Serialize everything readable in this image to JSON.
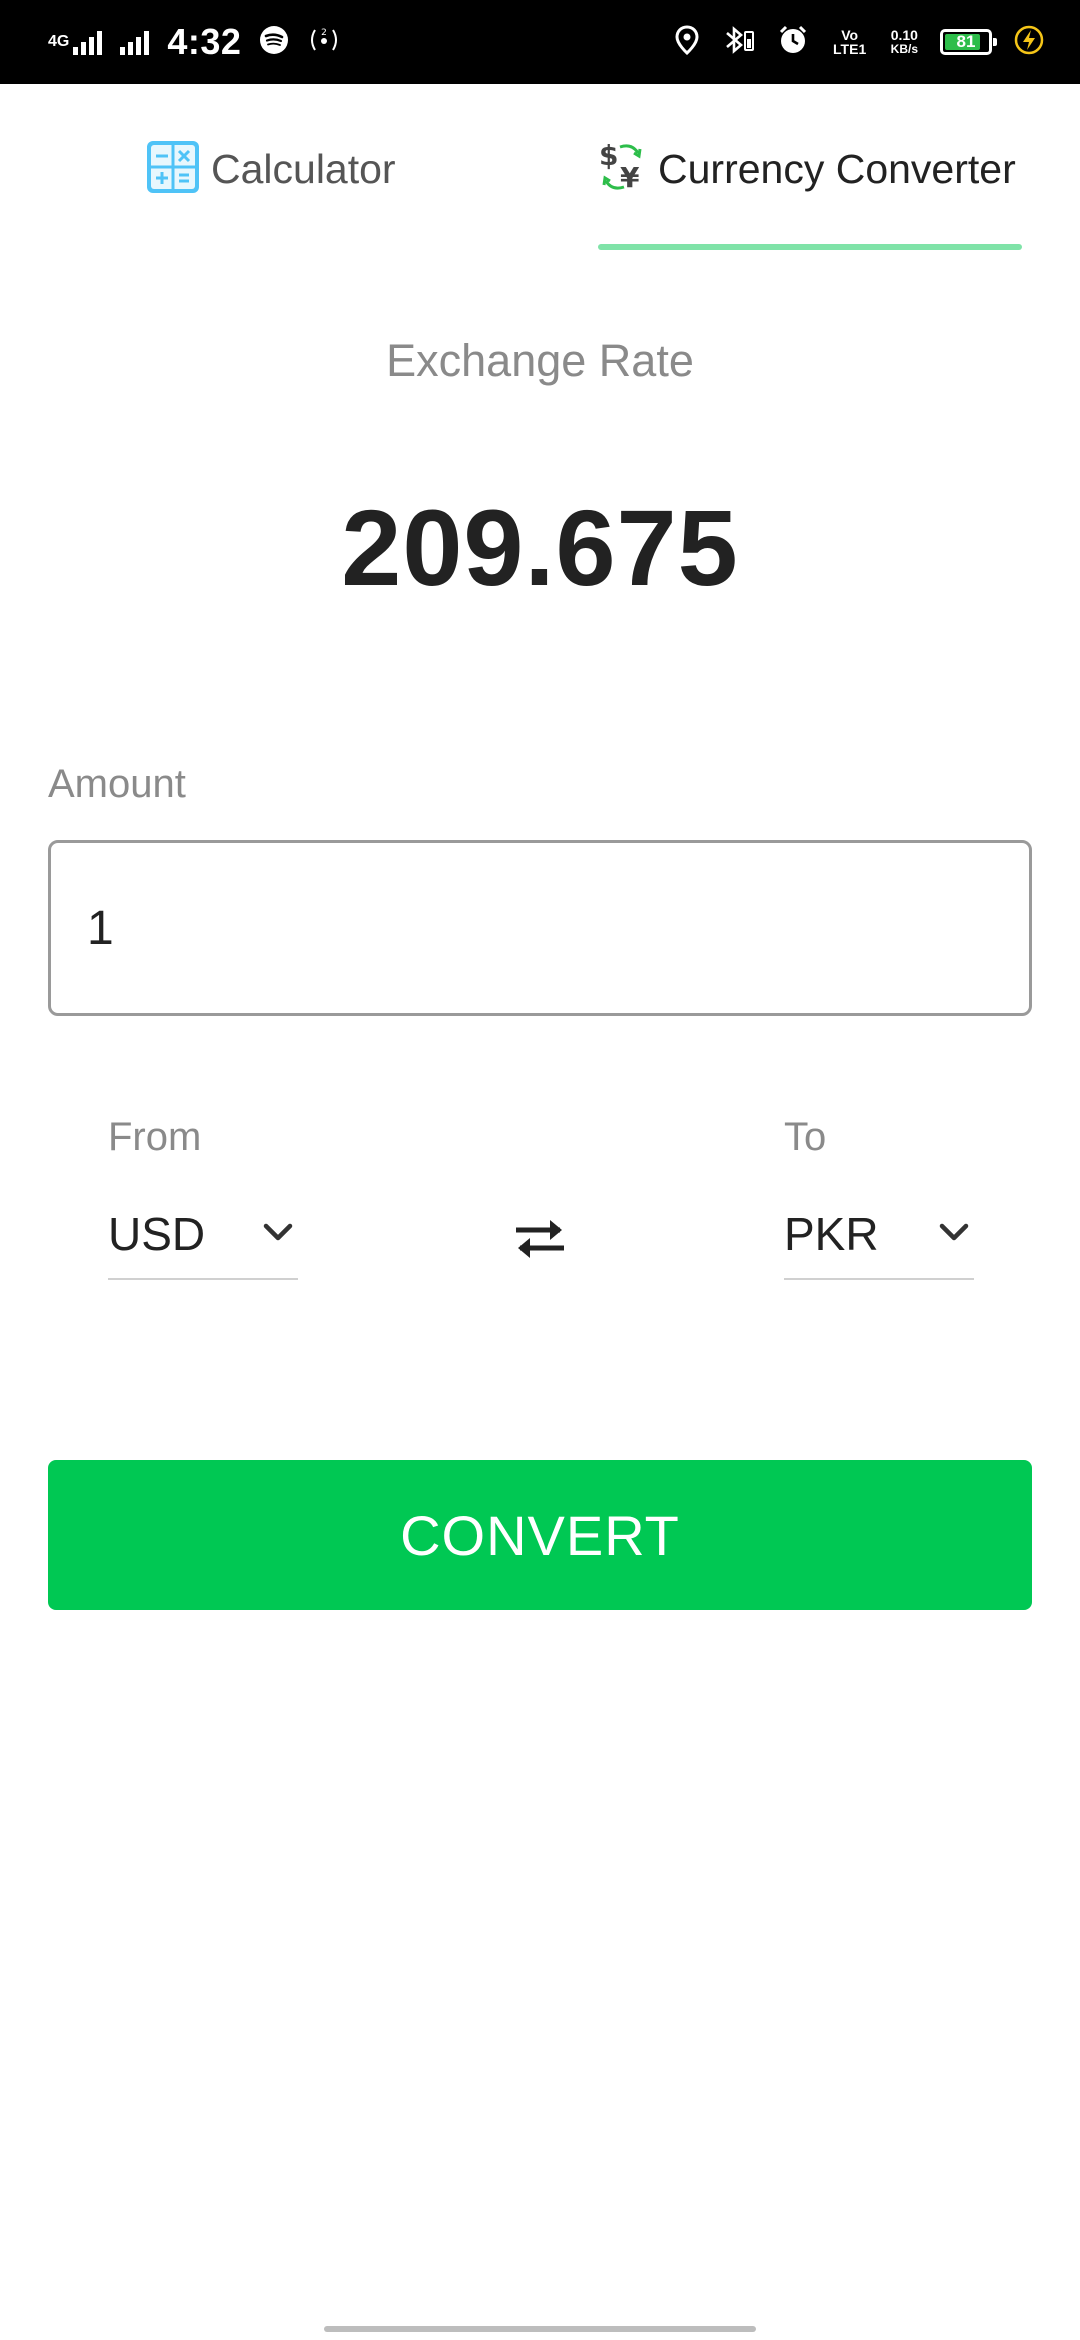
{
  "status_bar": {
    "network_type": "4G",
    "time": "4:32",
    "volte": "Vo LTE1",
    "speed_value": "0.10",
    "speed_unit": "KB/s",
    "battery": "81"
  },
  "tabs": [
    {
      "label": "Calculator",
      "icon": "calculator-icon",
      "selected": false
    },
    {
      "label": "Currency Converter",
      "icon": "currency-exchange-icon",
      "selected": true
    }
  ],
  "exchange": {
    "label": "Exchange Rate",
    "value": "209.675"
  },
  "amount": {
    "label": "Amount",
    "value": "1"
  },
  "from": {
    "label": "From",
    "value": "USD"
  },
  "to": {
    "label": "To",
    "value": "PKR"
  },
  "convert_label": "CONVERT",
  "colors": {
    "accent": "#00c853",
    "tab_indicator": "#7fe3a8",
    "calculator_icon": "#4fc3f7"
  }
}
